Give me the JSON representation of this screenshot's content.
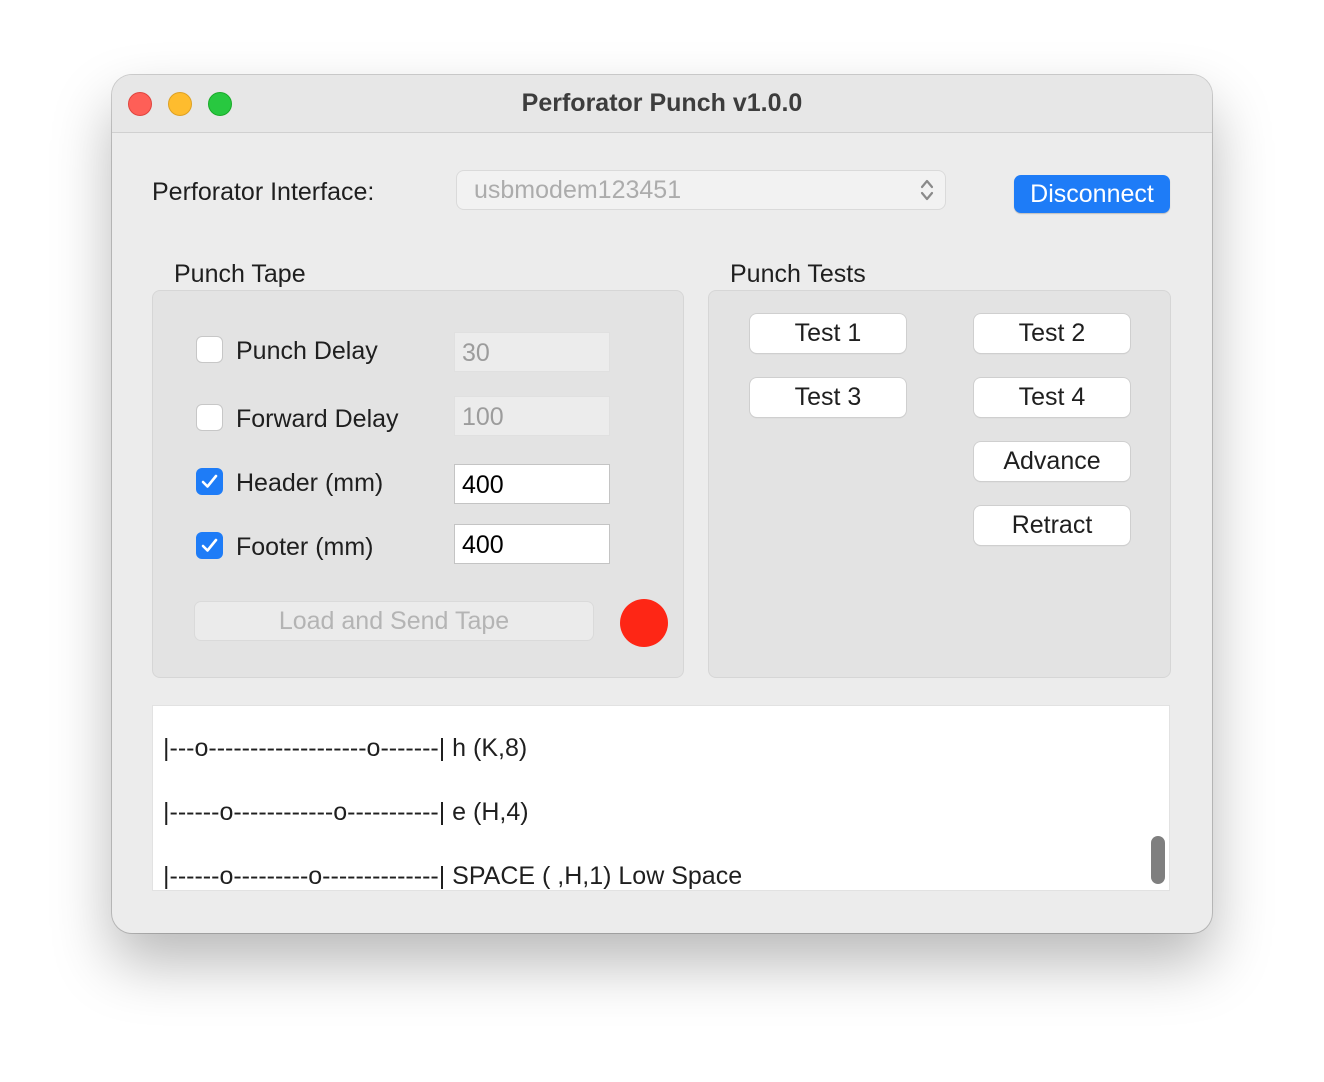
{
  "window": {
    "title": "Perforator Punch v1.0.0"
  },
  "interface": {
    "label": "Perforator Interface:",
    "selected_port": "usbmodem123451",
    "disconnect_label": "Disconnect"
  },
  "punch_tape": {
    "title": "Punch Tape",
    "options": [
      {
        "label": "Punch Delay",
        "checked": false,
        "value": "30"
      },
      {
        "label": "Forward Delay",
        "checked": false,
        "value": "100"
      },
      {
        "label": "Header (mm)",
        "checked": true,
        "value": "400"
      },
      {
        "label": "Footer (mm)",
        "checked": true,
        "value": "400"
      }
    ],
    "send_button_label": "Load and Send Tape",
    "status_color": "#fe2615"
  },
  "punch_tests": {
    "title": "Punch Tests",
    "buttons": [
      "Test 1",
      "Test 2",
      "Test 3",
      "Test 4",
      "Advance",
      "Retract"
    ]
  },
  "log": {
    "lines": [
      "|---o-------------------o-------| h (K,8)",
      "|------o------------o-----------| e (H,4)",
      "|------o---------o--------------| SPACE ( ,H,1) Low Space"
    ]
  },
  "colors": {
    "accent": "#1e7cf7",
    "close": "#fe5f57",
    "minimize": "#febc2e",
    "zoom": "#28c840"
  }
}
